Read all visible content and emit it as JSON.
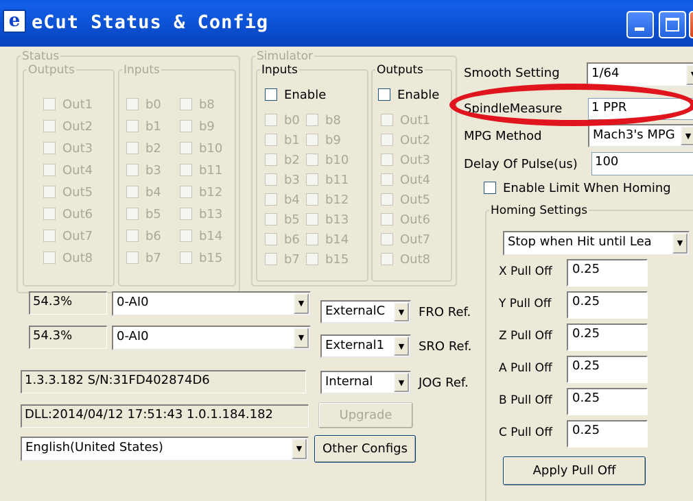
{
  "window": {
    "title": "eCut Status & Config",
    "icon_letter": "e"
  },
  "status": {
    "legend": "Status",
    "outputs": {
      "legend": "Outputs",
      "items": [
        "Out1",
        "Out2",
        "Out3",
        "Out4",
        "Out5",
        "Out6",
        "Out7",
        "Out8"
      ]
    },
    "inputs": {
      "legend": "Inputs",
      "col1": [
        "b0",
        "b1",
        "b2",
        "b3",
        "b4",
        "b5",
        "b6",
        "b7"
      ],
      "col2": [
        "b8",
        "b9",
        "b10",
        "b11",
        "b12",
        "b13",
        "b14",
        "b15"
      ]
    }
  },
  "simulator": {
    "legend": "Simulator",
    "inputs": {
      "legend": "Inputs",
      "enable_label": "Enable",
      "col1": [
        "b0",
        "b1",
        "b2",
        "b3",
        "b4",
        "b5",
        "b6",
        "b7"
      ],
      "col2": [
        "b8",
        "b9",
        "b10",
        "b11",
        "b12",
        "b13",
        "b14",
        "b15"
      ]
    },
    "outputs": {
      "legend": "Outputs",
      "enable_label": "Enable",
      "items": [
        "Out1",
        "Out2",
        "Out3",
        "Out4",
        "Out5",
        "Out6",
        "Out7",
        "Out8"
      ]
    }
  },
  "settings": {
    "smooth_label": "Smooth Setting",
    "smooth_value": "1/64",
    "spindle_label": "SpindleMeasure",
    "spindle_value": "1 PPR",
    "mpg_label": "MPG Method",
    "mpg_value": "Mach3's MPG",
    "delay_label": "Delay Of Pulse(us)",
    "delay_value": "100",
    "limit_homing_label": "Enable Limit When Homing"
  },
  "homing": {
    "legend": "Homing Settings",
    "mode_value": "Stop when Hit until Lea",
    "pulloffs": [
      {
        "label": "X Pull Off",
        "value": "0.25"
      },
      {
        "label": "Y Pull Off",
        "value": "0.25"
      },
      {
        "label": "Z Pull Off",
        "value": "0.25"
      },
      {
        "label": "A Pull Off",
        "value": "0.25"
      },
      {
        "label": "B Pull Off",
        "value": "0.25"
      },
      {
        "label": "C Pull Off",
        "value": "0.25"
      }
    ],
    "apply_label": "Apply Pull Off"
  },
  "analog": {
    "fro": {
      "percent": "54.3%",
      "input": "0-AI0",
      "source": "ExternalC",
      "label": "FRO Ref."
    },
    "sro": {
      "percent": "54.3%",
      "input": "0-AI0",
      "source": "External1",
      "label": "SRO Ref."
    },
    "jog": {
      "source": "Internal",
      "label": "JOG Ref."
    }
  },
  "info": {
    "serial": "1.3.3.182 S/N:31FD402874D6",
    "dll": "DLL:2014/04/12 17:51:43  1.0.1.184.182",
    "upgrade_label": "Upgrade",
    "language": "English(United States)",
    "other_configs_label": "Other Configs"
  },
  "colors": {
    "titlebar": "#0b4fd0",
    "dialog_bg": "#ece9d8",
    "highlight": "#e0141c",
    "disabled_text": "#a8a89a"
  }
}
